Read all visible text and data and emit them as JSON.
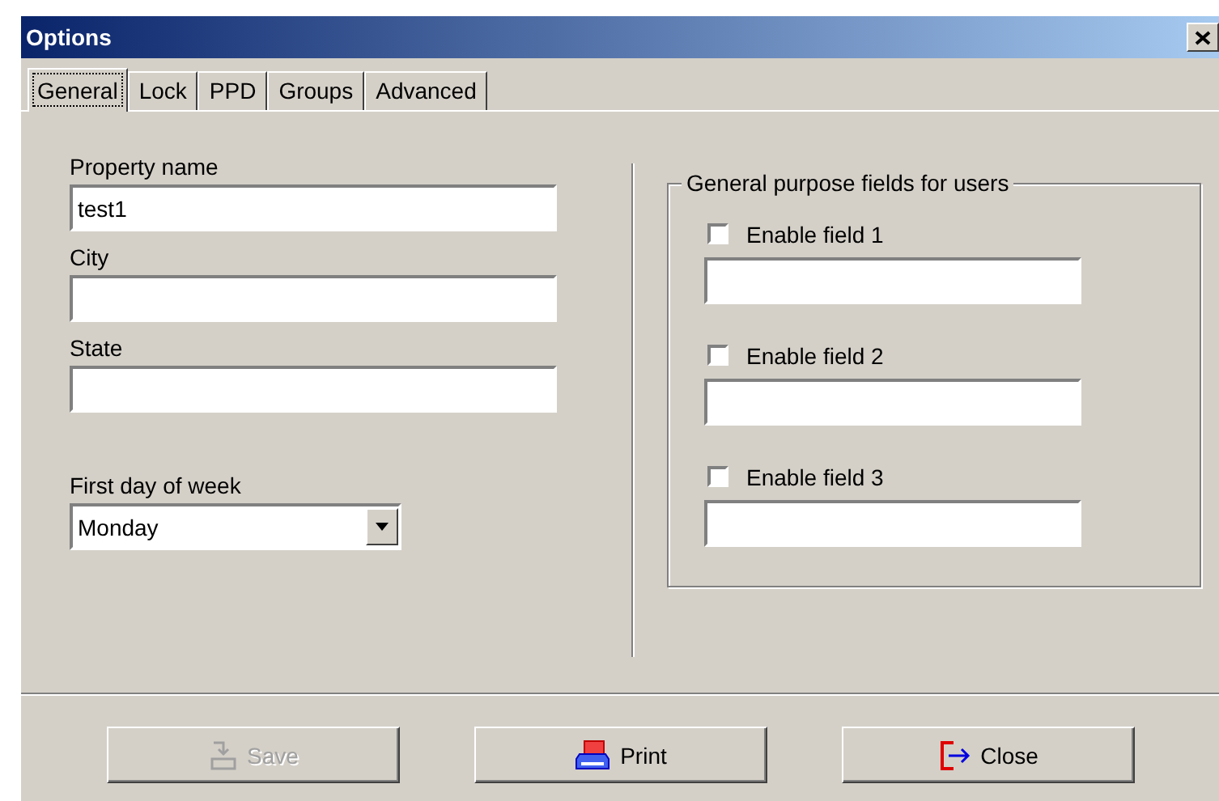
{
  "window": {
    "title": "Options"
  },
  "tabs": [
    {
      "label": "General",
      "selected": true
    },
    {
      "label": "Lock",
      "selected": false
    },
    {
      "label": "PPD",
      "selected": false
    },
    {
      "label": "Groups",
      "selected": false
    },
    {
      "label": "Advanced",
      "selected": false
    }
  ],
  "fields": [
    {
      "label": "Property name",
      "value": "test1"
    },
    {
      "label": "City"
    },
    {
      "label": "State"
    }
  ],
  "first_day": {
    "label": "First day of week",
    "value": "Monday"
  },
  "group": {
    "title": "General purpose fields for users",
    "items": [
      {
        "label": "Enable field 1",
        "checked": false
      },
      {
        "label": "Enable field 2",
        "checked": false
      },
      {
        "label": "Enable field 3",
        "checked": false
      }
    ]
  },
  "buttons": [
    {
      "label": "Save",
      "kind": "save",
      "disabled": true
    },
    {
      "label": "Print",
      "kind": "print",
      "disabled": false
    },
    {
      "label": "Close",
      "kind": "close",
      "disabled": false
    }
  ]
}
